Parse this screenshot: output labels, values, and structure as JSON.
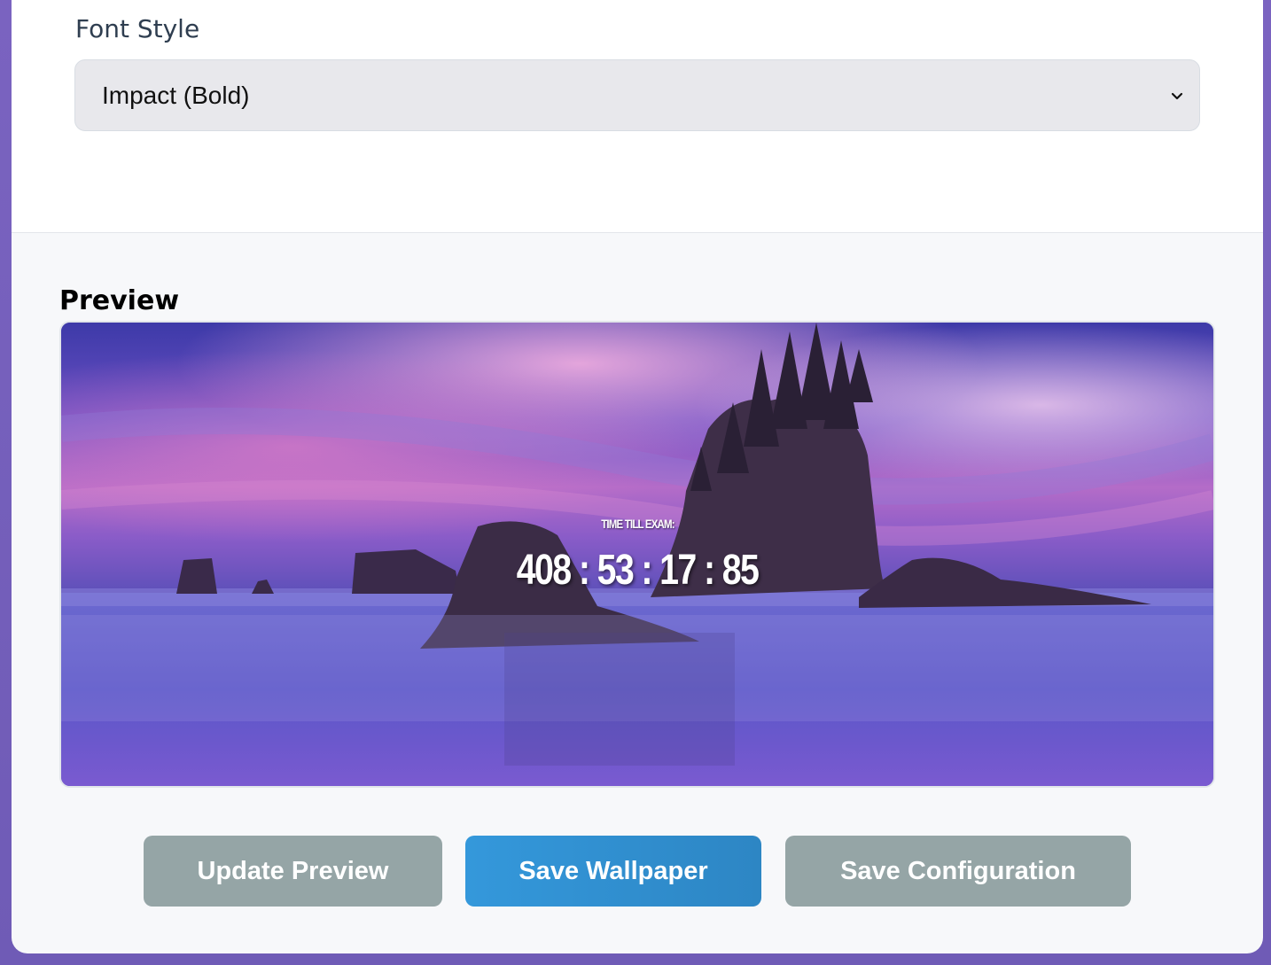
{
  "font_style": {
    "label": "Font Style",
    "selected": "Impact (Bold)",
    "chevron_icon": "chevron-down-icon"
  },
  "preview": {
    "title": "Preview",
    "timer_label": "TIME TILL EXAM:",
    "timer_value": "408 : 53 : 17 : 85"
  },
  "actions": {
    "update_preview": "Update Preview",
    "save_wallpaper": "Save Wallpaper",
    "save_configuration": "Save Configuration"
  },
  "colors": {
    "accent_blue": "#3498db",
    "button_gray": "#95a5a6",
    "page_background": "#7a63c0"
  }
}
